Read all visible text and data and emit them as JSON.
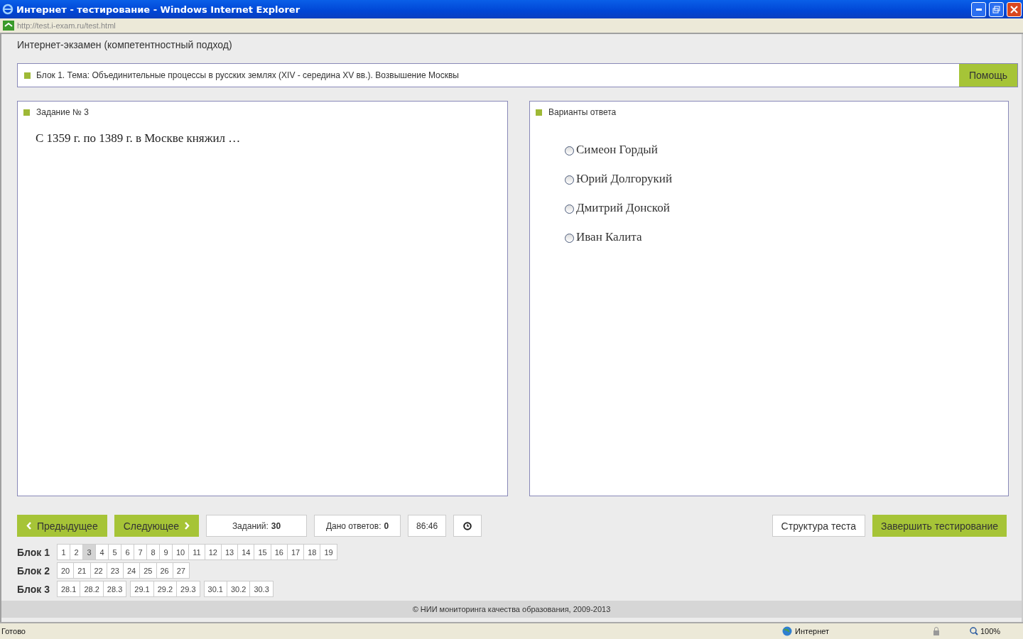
{
  "window": {
    "title": "Интернет - тестирование - Windows Internet Explorer",
    "url": "http://test.i-exam.ru/test.html"
  },
  "page_title": "Интернет-экзамен (компетентностный подход)",
  "topic": {
    "text": "Блок 1. Тема: Объединительные процессы в русских землях (XIV - середина XV вв.). Возвышение Москвы",
    "help_button": "Помощь"
  },
  "task": {
    "heading": "Задание № 3",
    "question": "С 1359 г. по 1389 г. в Москве княжил …"
  },
  "answers": {
    "heading": "Варианты ответа",
    "options": [
      {
        "label": "Симеон Гордый",
        "selected": false
      },
      {
        "label": "Юрий Долгорукий",
        "selected": false
      },
      {
        "label": "Дмитрий Донской",
        "selected": false
      },
      {
        "label": "Иван Калита",
        "selected": false
      }
    ]
  },
  "toolbar": {
    "prev": "Предыдущее",
    "next": "Следующее",
    "tasks_label": "Заданий:",
    "tasks_value": "30",
    "answered_label": "Дано ответов:",
    "answered_value": "0",
    "timer": "86:46",
    "structure": "Структура теста",
    "finish": "Завершить тестирование"
  },
  "blocks": [
    {
      "label": "Блок 1",
      "groups": [
        [
          {
            "n": "1",
            "selected": false
          },
          {
            "n": "2",
            "selected": false
          },
          {
            "n": "3",
            "selected": true
          },
          {
            "n": "4",
            "selected": false
          },
          {
            "n": "5",
            "selected": false
          },
          {
            "n": "6",
            "selected": false
          },
          {
            "n": "7",
            "selected": false
          },
          {
            "n": "8",
            "selected": false
          },
          {
            "n": "9",
            "selected": false
          },
          {
            "n": "10",
            "selected": false
          },
          {
            "n": "11",
            "selected": false
          },
          {
            "n": "12",
            "selected": false
          },
          {
            "n": "13",
            "selected": false
          },
          {
            "n": "14",
            "selected": false
          },
          {
            "n": "15",
            "selected": false
          },
          {
            "n": "16",
            "selected": false
          },
          {
            "n": "17",
            "selected": false
          },
          {
            "n": "18",
            "selected": false
          },
          {
            "n": "19",
            "selected": false
          }
        ]
      ]
    },
    {
      "label": "Блок 2",
      "groups": [
        [
          {
            "n": "20",
            "selected": false
          },
          {
            "n": "21",
            "selected": false
          },
          {
            "n": "22",
            "selected": false
          },
          {
            "n": "23",
            "selected": false
          },
          {
            "n": "24",
            "selected": false
          },
          {
            "n": "25",
            "selected": false
          },
          {
            "n": "26",
            "selected": false
          },
          {
            "n": "27",
            "selected": false
          }
        ]
      ]
    },
    {
      "label": "Блок 3",
      "groups": [
        [
          {
            "n": "28.1",
            "selected": false
          },
          {
            "n": "28.2",
            "selected": false
          },
          {
            "n": "28.3",
            "selected": false
          }
        ],
        [
          {
            "n": "29.1",
            "selected": false
          },
          {
            "n": "29.2",
            "selected": false
          },
          {
            "n": "29.3",
            "selected": false
          }
        ],
        [
          {
            "n": "30.1",
            "selected": false
          },
          {
            "n": "30.2",
            "selected": false
          },
          {
            "n": "30.3",
            "selected": false
          }
        ]
      ]
    }
  ],
  "footer": "© НИИ мониторинга качества образования, 2009-2013",
  "status_bar": {
    "status": "Готово",
    "zone": "Интернет",
    "zoom": "100%"
  }
}
